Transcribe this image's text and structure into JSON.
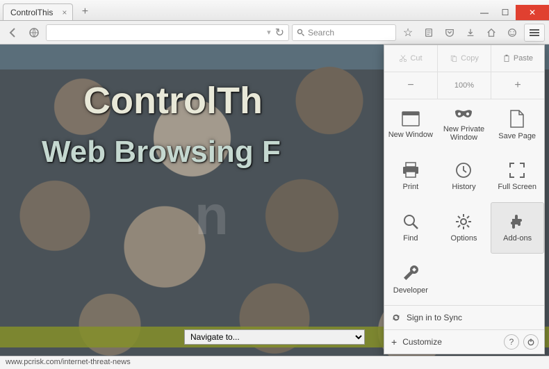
{
  "tab": {
    "title": "ControlThis",
    "close": "×"
  },
  "newtab": "+",
  "window": {
    "min": "—",
    "max": "☐",
    "close": "✕"
  },
  "nav": {
    "search_placeholder": "Search",
    "reload": "↻"
  },
  "page": {
    "hero1": "ControlTh",
    "hero2": "Web Browsing F",
    "navsel": "Navigate to..."
  },
  "menu": {
    "cut": "Cut",
    "copy": "Copy",
    "paste": "Paste",
    "zoom_minus": "−",
    "zoom": "100%",
    "zoom_plus": "+",
    "items": [
      {
        "id": "new-window",
        "label": "New Window"
      },
      {
        "id": "new-private",
        "label": "New Private\nWindow"
      },
      {
        "id": "save-page",
        "label": "Save Page"
      },
      {
        "id": "print",
        "label": "Print"
      },
      {
        "id": "history",
        "label": "History"
      },
      {
        "id": "fullscreen",
        "label": "Full Screen"
      },
      {
        "id": "find",
        "label": "Find"
      },
      {
        "id": "options",
        "label": "Options"
      },
      {
        "id": "addons",
        "label": "Add-ons"
      },
      {
        "id": "developer",
        "label": "Developer"
      }
    ],
    "signin": "Sign in to Sync",
    "customize": "Customize",
    "help": "?",
    "power": "⏻"
  },
  "status_url": "www.pcrisk.com/internet-threat-news"
}
